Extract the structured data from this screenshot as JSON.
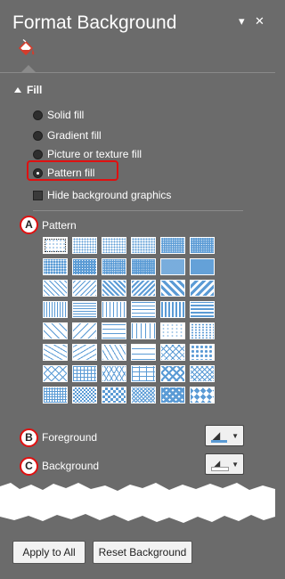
{
  "header": {
    "title": "Format Background",
    "dropdown_glyph": "▾",
    "close_glyph": "✕",
    "tab_icon": "paint-bucket-icon"
  },
  "fill_section": {
    "label": "Fill",
    "options": [
      {
        "label": "Solid fill",
        "type": "radio",
        "selected": false
      },
      {
        "label": "Gradient fill",
        "type": "radio",
        "selected": false
      },
      {
        "label": "Picture or texture fill",
        "type": "radio",
        "selected": false
      },
      {
        "label": "Pattern fill",
        "type": "radio",
        "selected": true
      },
      {
        "label": "Hide background graphics",
        "type": "checkbox",
        "checked": false
      }
    ]
  },
  "markers": {
    "a": "A",
    "b": "B",
    "c": "C"
  },
  "pattern": {
    "label": "Pattern",
    "rows": 8,
    "cols": 6,
    "fg_color": "#5b9bd5",
    "bg_color": "#ffffff"
  },
  "foreground": {
    "label": "Foreground",
    "color": "#5b9bd5"
  },
  "background": {
    "label": "Background",
    "color": "#ffffff"
  },
  "buttons": {
    "apply_all": "Apply to All",
    "reset": "Reset Background"
  },
  "colors": {
    "panel_bg": "#6b6b6b",
    "highlight": "#e01010",
    "accent": "#5b9bd5"
  }
}
